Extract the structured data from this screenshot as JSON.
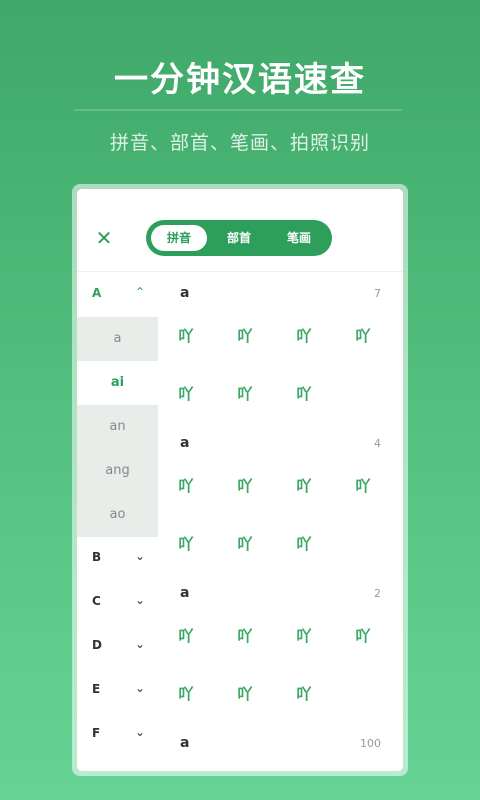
{
  "hero": {
    "title": "一分钟汉语速查",
    "subtitle": "拼音、部首、笔画、拍照识别"
  },
  "tabs": [
    "拼音",
    "部首",
    "笔画"
  ],
  "active_tab": "拼音",
  "letters": [
    {
      "letter": "A",
      "expanded": true,
      "syllables": [
        "a",
        "ai",
        "an",
        "ang",
        "ao"
      ],
      "selected": "ai"
    },
    {
      "letter": "B",
      "expanded": false
    },
    {
      "letter": "C",
      "expanded": false
    },
    {
      "letter": "D",
      "expanded": false
    },
    {
      "letter": "E",
      "expanded": false
    },
    {
      "letter": "F",
      "expanded": false
    }
  ],
  "sections": [
    {
      "pinyin": "a",
      "count": "7",
      "chars": [
        "吖",
        "吖",
        "吖",
        "吖",
        "吖",
        "吖",
        "吖"
      ]
    },
    {
      "pinyin": "a",
      "count": "4",
      "chars": [
        "吖",
        "吖",
        "吖",
        "吖",
        "吖",
        "吖",
        "吖"
      ]
    },
    {
      "pinyin": "a",
      "count": "2",
      "chars": [
        "吖",
        "吖",
        "吖",
        "吖",
        "吖",
        "吖",
        "吖"
      ]
    },
    {
      "pinyin": "a",
      "count": "100",
      "chars": []
    }
  ],
  "icons": {
    "close": "close-icon",
    "expand": "chevron-up-icon",
    "collapse": "chevron-down-icon"
  },
  "colors": {
    "accent": "#2e9e5b",
    "glyph": "#3aa866",
    "selected_bg": "#e8ede9"
  }
}
